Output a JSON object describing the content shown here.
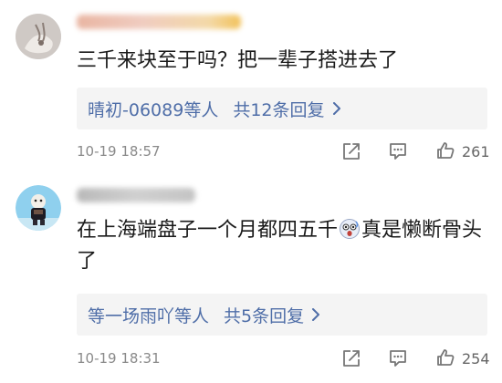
{
  "comments": [
    {
      "text": "三千来块至于吗？把一辈子搭进去了",
      "reply_users": "晴初-06089",
      "reply_suffix": "等人",
      "reply_count": "共12条回复",
      "timestamp": "10-19 18:57",
      "likes": "261"
    },
    {
      "text_before_emoji": "在上海端盘子一个月都四五千",
      "text_after_emoji": "真是懒断骨头了",
      "reply_users": "等一场雨吖",
      "reply_suffix": "等人",
      "reply_count": "共5条回复",
      "timestamp": "10-19 18:31",
      "likes": "254"
    }
  ],
  "icons": {
    "share": "share-icon",
    "comment": "comment-icon",
    "like": "like-icon",
    "chevron": "chevron-right-icon",
    "inline_emoji": "shocked-face-emoji-icon"
  },
  "colors": {
    "link_blue": "#4f6ea8",
    "reply_bg": "#f4f4f4",
    "meta_gray": "#8a8a8a"
  }
}
